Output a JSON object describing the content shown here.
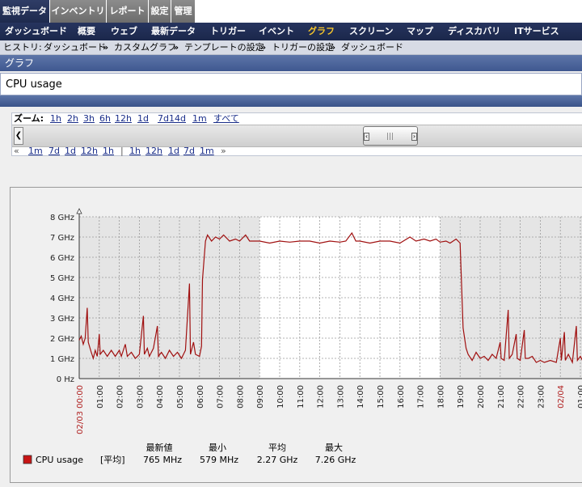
{
  "top_tabs": [
    {
      "label": "監視データ",
      "active": true
    },
    {
      "label": "インベントリ",
      "active": false
    },
    {
      "label": "レポート",
      "active": false
    },
    {
      "label": "設定",
      "active": false
    },
    {
      "label": "管理",
      "active": false
    }
  ],
  "menu": [
    {
      "label": "ダッシュボード",
      "selected": false
    },
    {
      "label": "概要",
      "selected": false
    },
    {
      "label": "ウェブ",
      "selected": false
    },
    {
      "label": "最新データ",
      "selected": false
    },
    {
      "label": "トリガー",
      "selected": false
    },
    {
      "label": "イベント",
      "selected": false
    },
    {
      "label": "グラフ",
      "selected": true
    },
    {
      "label": "スクリーン",
      "selected": false
    },
    {
      "label": "マップ",
      "selected": false
    },
    {
      "label": "ディスカバリ",
      "selected": false
    },
    {
      "label": "ITサービス",
      "selected": false
    }
  ],
  "history": {
    "label": "ヒストリ:",
    "items": [
      "ダッシュボード",
      "カスタムグラフ",
      "テンプレートの設定",
      "トリガーの設定",
      "ダッシュボード"
    ],
    "separator": "»"
  },
  "section_title": "グラフ",
  "graph_name": "CPU usage",
  "zoom": {
    "label": "ズーム:",
    "options": [
      "1h",
      "2h",
      "3h",
      "6h",
      "12h",
      "1d",
      "7d",
      "14d",
      "1m",
      "すべて"
    ]
  },
  "nav": {
    "back_arrows": "«",
    "back": [
      "1m",
      "7d",
      "1d",
      "12h",
      "1h"
    ],
    "divider": "|",
    "forward": [
      "1h",
      "12h",
      "1d",
      "7d",
      "1m"
    ],
    "forward_arrows": "»"
  },
  "legend": {
    "headers": {
      "last": "最新値",
      "min": "最小",
      "avg": "平均",
      "max": "最大"
    },
    "item": {
      "name": "CPU usage",
      "func": "[平均]",
      "last": "765 MHz",
      "min": "579 MHz",
      "avg": "2.27 GHz",
      "max": "7.26 GHz",
      "color": "#c81414"
    }
  },
  "chart_data": {
    "type": "line",
    "y_ticks": [
      "0 Hz",
      "1 GHz",
      "2 GHz",
      "3 GHz",
      "4 GHz",
      "5 GHz",
      "6 GHz",
      "7 GHz",
      "8 GHz"
    ],
    "ylim": [
      0,
      8
    ],
    "y_unit": "GHz",
    "x_ticks": [
      "02/03 00:00",
      "01:00",
      "02:00",
      "03:00",
      "04:00",
      "05:00",
      "06:00",
      "07:00",
      "08:00",
      "09:00",
      "10:00",
      "11:00",
      "12:00",
      "13:00",
      "14:00",
      "15:00",
      "16:00",
      "17:00",
      "18:00",
      "19:00",
      "20:00",
      "21:00",
      "22:00",
      "23:00",
      "02/04",
      "01:00"
    ],
    "x_tick_hours": [
      0,
      1,
      2,
      3,
      4,
      5,
      6,
      7,
      8,
      9,
      10,
      11,
      12,
      13,
      14,
      15,
      16,
      17,
      18,
      19,
      20,
      21,
      22,
      23,
      24,
      25
    ],
    "red_tick_indices": [
      0,
      24
    ],
    "work_time_hours": [
      9,
      18
    ],
    "xlim_hours": [
      0,
      25.1
    ],
    "series": [
      {
        "name": "CPU usage",
        "color": "#a01010",
        "points": [
          [
            0,
            1.9
          ],
          [
            0.1,
            2.1
          ],
          [
            0.2,
            1.7
          ],
          [
            0.3,
            2.0
          ],
          [
            0.4,
            3.5
          ],
          [
            0.45,
            1.8
          ],
          [
            0.6,
            1.3
          ],
          [
            0.7,
            1.0
          ],
          [
            0.8,
            1.4
          ],
          [
            0.9,
            1.1
          ],
          [
            1.0,
            2.2
          ],
          [
            1.05,
            1.2
          ],
          [
            1.2,
            1.4
          ],
          [
            1.4,
            1.1
          ],
          [
            1.6,
            1.4
          ],
          [
            1.8,
            1.1
          ],
          [
            2.0,
            1.4
          ],
          [
            2.1,
            1.1
          ],
          [
            2.3,
            1.7
          ],
          [
            2.4,
            1.1
          ],
          [
            2.6,
            1.3
          ],
          [
            2.8,
            1.0
          ],
          [
            3.0,
            1.2
          ],
          [
            3.2,
            3.1
          ],
          [
            3.25,
            1.2
          ],
          [
            3.4,
            1.5
          ],
          [
            3.5,
            1.1
          ],
          [
            3.7,
            1.5
          ],
          [
            3.9,
            2.6
          ],
          [
            3.95,
            1.1
          ],
          [
            4.1,
            1.3
          ],
          [
            4.3,
            1.0
          ],
          [
            4.5,
            1.4
          ],
          [
            4.7,
            1.1
          ],
          [
            4.9,
            1.3
          ],
          [
            5.1,
            1.0
          ],
          [
            5.3,
            1.4
          ],
          [
            5.5,
            4.7
          ],
          [
            5.55,
            1.2
          ],
          [
            5.7,
            1.8
          ],
          [
            5.8,
            1.2
          ],
          [
            6.0,
            1.1
          ],
          [
            6.1,
            1.6
          ],
          [
            6.15,
            4.9
          ],
          [
            6.3,
            6.8
          ],
          [
            6.4,
            7.1
          ],
          [
            6.6,
            6.8
          ],
          [
            6.8,
            7.0
          ],
          [
            7.0,
            6.9
          ],
          [
            7.2,
            7.1
          ],
          [
            7.5,
            6.8
          ],
          [
            7.8,
            6.9
          ],
          [
            8.0,
            6.8
          ],
          [
            8.3,
            7.1
          ],
          [
            8.5,
            6.8
          ],
          [
            9.0,
            6.8
          ],
          [
            9.5,
            6.7
          ],
          [
            10.0,
            6.8
          ],
          [
            10.5,
            6.75
          ],
          [
            11.0,
            6.8
          ],
          [
            11.5,
            6.8
          ],
          [
            12.0,
            6.7
          ],
          [
            12.5,
            6.8
          ],
          [
            13.0,
            6.75
          ],
          [
            13.3,
            6.8
          ],
          [
            13.6,
            7.2
          ],
          [
            13.8,
            6.8
          ],
          [
            14.0,
            6.8
          ],
          [
            14.5,
            6.7
          ],
          [
            15.0,
            6.8
          ],
          [
            15.5,
            6.8
          ],
          [
            16.0,
            6.7
          ],
          [
            16.5,
            7.0
          ],
          [
            16.8,
            6.8
          ],
          [
            17.2,
            6.9
          ],
          [
            17.5,
            6.8
          ],
          [
            17.8,
            6.9
          ],
          [
            18.0,
            6.75
          ],
          [
            18.3,
            6.8
          ],
          [
            18.5,
            6.7
          ],
          [
            18.8,
            6.9
          ],
          [
            19.0,
            6.7
          ],
          [
            19.15,
            2.5
          ],
          [
            19.3,
            1.5
          ],
          [
            19.4,
            1.2
          ],
          [
            19.6,
            0.9
          ],
          [
            19.8,
            1.3
          ],
          [
            20.0,
            1.0
          ],
          [
            20.2,
            1.1
          ],
          [
            20.4,
            0.9
          ],
          [
            20.6,
            1.2
          ],
          [
            20.8,
            1.0
          ],
          [
            21.0,
            1.8
          ],
          [
            21.05,
            1.0
          ],
          [
            21.2,
            0.9
          ],
          [
            21.4,
            3.4
          ],
          [
            21.45,
            1.0
          ],
          [
            21.6,
            1.2
          ],
          [
            21.8,
            2.2
          ],
          [
            21.85,
            1.0
          ],
          [
            22.0,
            0.9
          ],
          [
            22.2,
            2.4
          ],
          [
            22.25,
            1.0
          ],
          [
            22.4,
            1.0
          ],
          [
            22.6,
            1.1
          ],
          [
            22.8,
            0.8
          ],
          [
            23.0,
            0.9
          ],
          [
            23.2,
            0.8
          ],
          [
            23.5,
            0.9
          ],
          [
            23.8,
            0.8
          ],
          [
            24.0,
            2.0
          ],
          [
            24.05,
            0.9
          ],
          [
            24.2,
            2.3
          ],
          [
            24.25,
            0.9
          ],
          [
            24.4,
            1.2
          ],
          [
            24.6,
            0.8
          ],
          [
            24.8,
            2.6
          ],
          [
            24.85,
            0.9
          ],
          [
            25.0,
            1.1
          ],
          [
            25.1,
            0.9
          ]
        ]
      }
    ]
  }
}
